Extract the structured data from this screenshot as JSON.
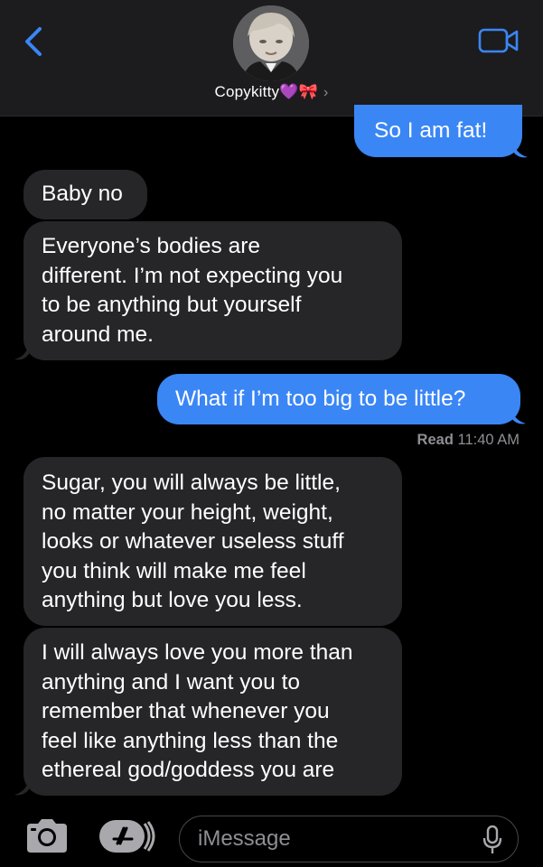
{
  "header": {
    "contact_name": "Copykitty💜🎀",
    "chevron": "›",
    "back_icon": "chevron-left-icon",
    "video_icon": "video-camera-icon",
    "accent_color": "#3a86f5"
  },
  "messages": [
    {
      "from": "me",
      "lines": [
        "So I am fat!"
      ]
    },
    {
      "from": "them",
      "lines": [
        "Baby no"
      ]
    },
    {
      "from": "them",
      "lines": [
        "Everyone’s bodies are",
        "different. I’m not expecting you",
        "to be anything but yourself",
        "around me."
      ]
    },
    {
      "from": "me",
      "lines": [
        "What if I’m too big to be little?"
      ]
    },
    {
      "from": "them",
      "lines": [
        "Sugar, you will always be little,",
        "no matter your height, weight,",
        "looks or whatever useless stuff",
        "you think will make me feel",
        "anything but love you less."
      ]
    },
    {
      "from": "them",
      "lines": [
        "I will always love you more than",
        "anything and I want you to",
        "remember that whenever you",
        "feel like anything less than the",
        "ethereal god/goddess you are"
      ]
    }
  ],
  "read_receipt": {
    "label": "Read",
    "time": "11:40 AM"
  },
  "input": {
    "placeholder": "iMessage",
    "camera_icon": "camera-icon",
    "apps_icon": "app-store-icon",
    "mic_icon": "microphone-icon"
  }
}
